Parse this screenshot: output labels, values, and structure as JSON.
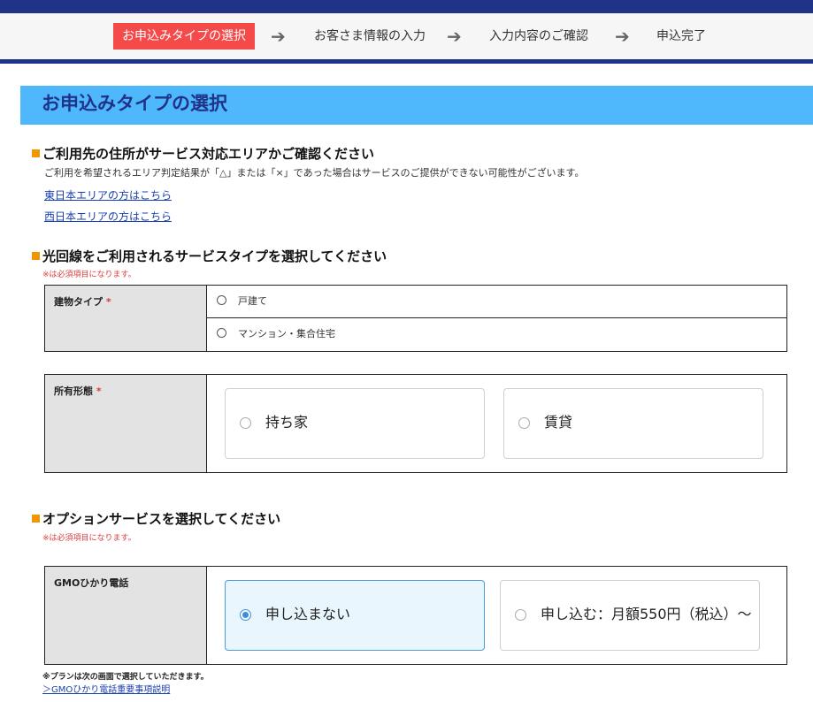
{
  "progress": {
    "steps": [
      {
        "label": "お申込みタイプの選択",
        "active": true
      },
      {
        "label": "お客さま情報の入力",
        "active": false
      },
      {
        "label": "入力内容のご確認",
        "active": false
      },
      {
        "label": "申込完了",
        "active": false
      }
    ],
    "arrow": "➔"
  },
  "page_title": "お申込みタイプの選択",
  "area_section": {
    "title": "ご利用先の住所がサービス対応エリアかご確認ください",
    "description": "ご利用を希望されるエリア判定結果が「△」または「×」であった場合はサービスのご提供ができない可能性がございます。",
    "east_link": "東日本エリアの方はこちら",
    "west_link": "西日本エリアの方はこちら"
  },
  "service_section": {
    "title": "光回線をご利用されるサービスタイプを選択してください",
    "required_note": "※は必須項目になります。",
    "building": {
      "label": "建物タイプ",
      "required_mark": "*",
      "options": [
        "戸建て",
        "マンション・集合住宅"
      ]
    },
    "ownership": {
      "label": "所有形態",
      "required_mark": "*",
      "options": [
        "持ち家",
        "賃貸"
      ]
    }
  },
  "option_section": {
    "title": "オプションサービスを選択してください",
    "required_note": "※は必須項目になります。",
    "phone": {
      "label": "GMOひかり電話",
      "options": [
        "申し込まない",
        "申し込む：月額550円（税込）～"
      ],
      "selected": "申し込まない"
    },
    "plan_note": "※プランは次の画面で選択していただきます。",
    "details_link": "＞GMOひかり電話重要事項説明"
  },
  "colors": {
    "navy": "#1f3389",
    "active_step": "#f44a4a",
    "heading_bg": "#4fb7fb",
    "bullet": "#f29600",
    "required": "#e03c3c",
    "link": "#1a3fb0",
    "selected_card_bg": "#eaf6fd"
  }
}
